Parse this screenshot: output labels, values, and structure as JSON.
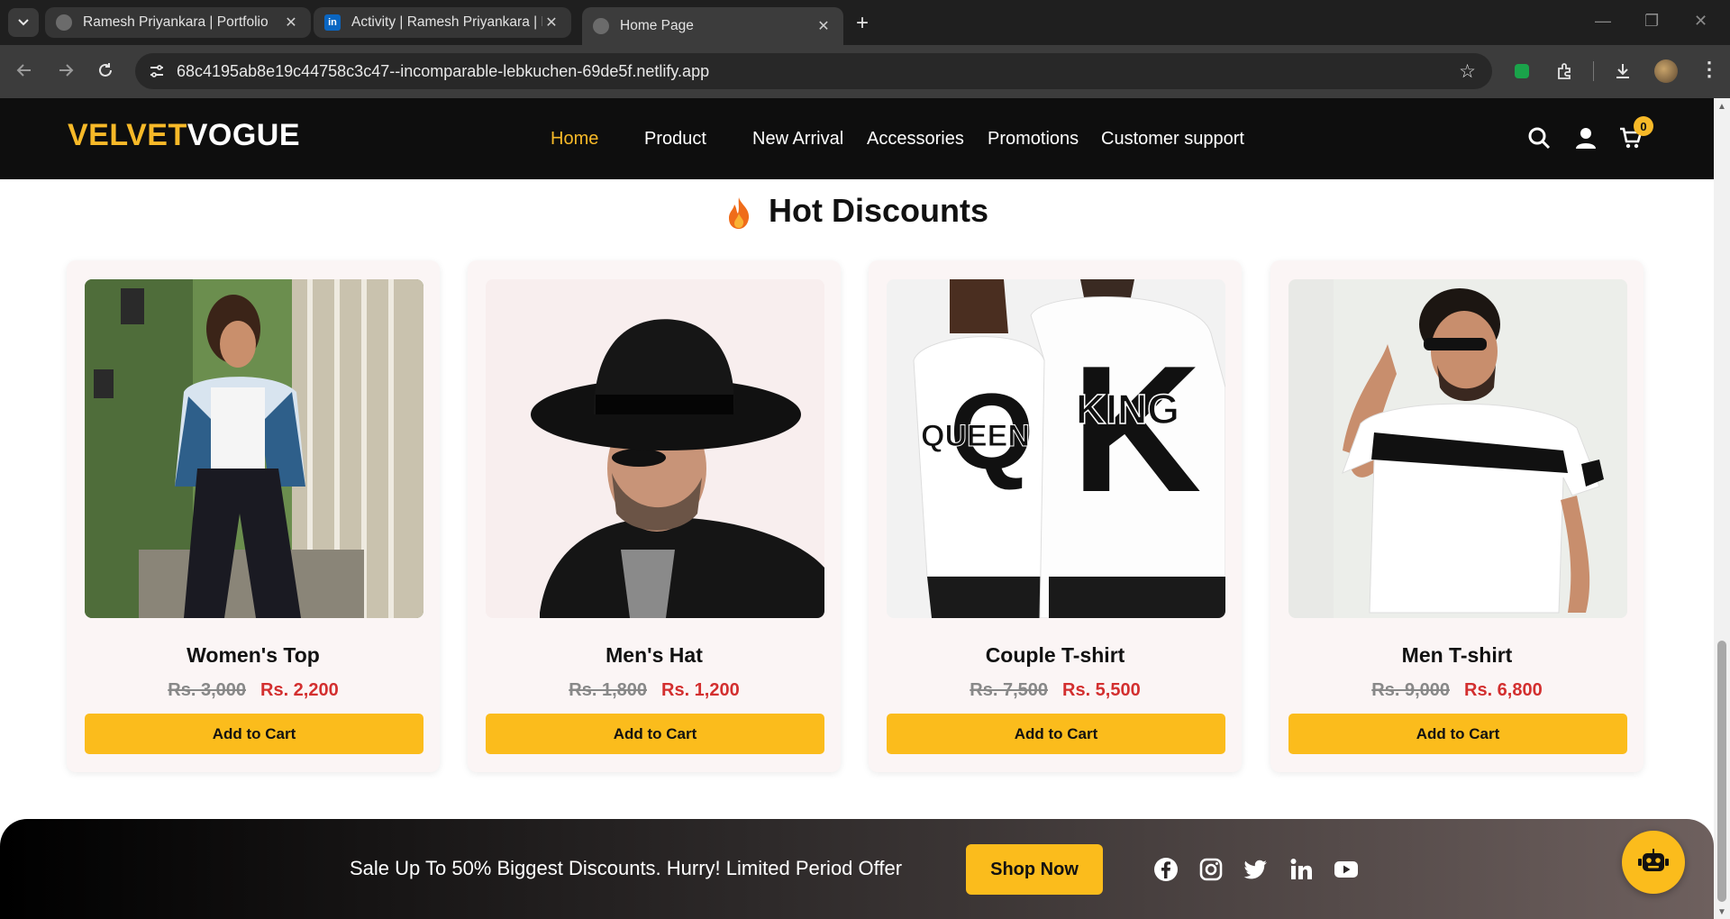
{
  "browser": {
    "tabs": [
      {
        "title": "Ramesh Priyankara | Portfolio",
        "favicon": "globe-icon"
      },
      {
        "title": "Activity | Ramesh Priyankara | Li",
        "favicon": "linkedin-icon"
      },
      {
        "title": "Home Page",
        "favicon": "globe-icon"
      }
    ],
    "url": "68c4195ab8e19c44758c3c47--incomparable-lebkuchen-69de5f.netlify.app"
  },
  "site": {
    "logo_part1": "VELVET",
    "logo_part2": "VOGUE",
    "nav": [
      "Home",
      "Product",
      "New Arrival",
      "Accessories",
      "Promotions",
      "Customer support"
    ],
    "cart_count": "0",
    "accent": "#f7b928"
  },
  "section": {
    "title": "Hot Discounts"
  },
  "products": [
    {
      "name": "Women's Top",
      "old_price": "Rs. 3,000",
      "new_price": "Rs. 2,200",
      "button": "Add to Cart"
    },
    {
      "name": "Men's Hat",
      "old_price": "Rs. 1,800",
      "new_price": "Rs. 1,200",
      "button": "Add to Cart"
    },
    {
      "name": "Couple T-shirt",
      "old_price": "Rs. 7,500",
      "new_price": "Rs. 5,500",
      "button": "Add to Cart"
    },
    {
      "name": "Men T-shirt",
      "old_price": "Rs. 9,000",
      "new_price": "Rs. 6,800",
      "button": "Add to Cart"
    }
  ],
  "couple_shirt_print": {
    "left": "QUEEN",
    "left_letter": "Q",
    "right": "KING",
    "right_letter": "K"
  },
  "promo": {
    "text": "Sale Up To 50% Biggest Discounts. Hurry! Limited Period Offer",
    "button": "Shop Now",
    "socials": [
      "facebook-icon",
      "instagram-icon",
      "twitter-icon",
      "linkedin-icon",
      "youtube-icon"
    ]
  }
}
